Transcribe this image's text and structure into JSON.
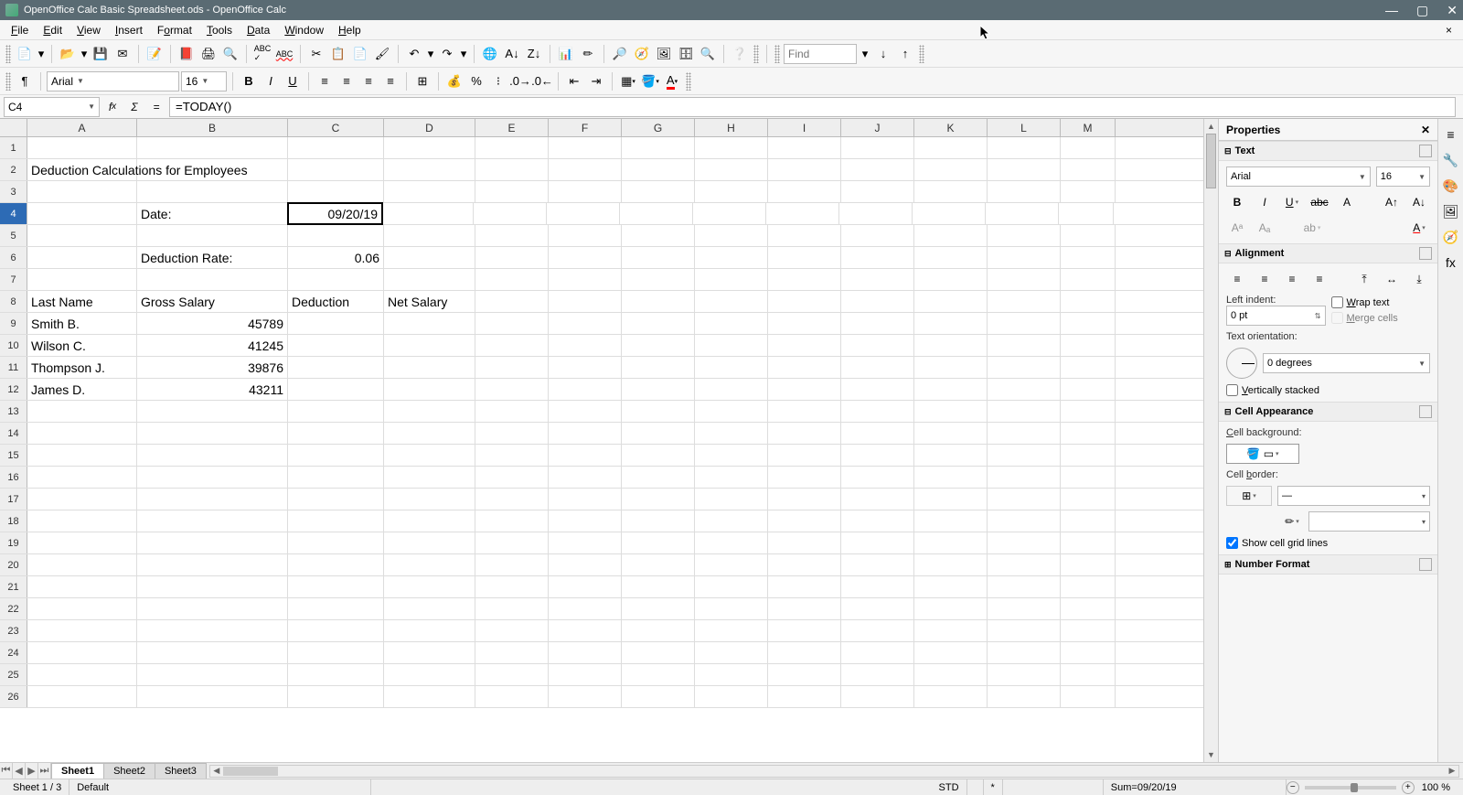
{
  "title": "OpenOffice Calc Basic Spreadsheet.ods - OpenOffice Calc",
  "menus": [
    "File",
    "Edit",
    "View",
    "Insert",
    "Format",
    "Tools",
    "Data",
    "Window",
    "Help"
  ],
  "font": {
    "name": "Arial",
    "size": "16"
  },
  "find_placeholder": "Find",
  "formula": {
    "cell_ref": "C4",
    "content": "=TODAY()"
  },
  "columns": [
    "A",
    "B",
    "C",
    "D",
    "E",
    "F",
    "G",
    "H",
    "I",
    "J",
    "K",
    "L",
    "M"
  ],
  "col_widths": [
    "cw-A",
    "cw-B",
    "cw-C",
    "cw-D",
    "cw-E",
    "cw-F",
    "cw-G",
    "cw-H",
    "cw-I",
    "cw-J",
    "cw-K",
    "cw-L",
    "cw-M"
  ],
  "active_cell": {
    "row": 4,
    "col_index": 2
  },
  "cells": {
    "2": {
      "A": "Deduction Calculations for Employees",
      "overflow": true
    },
    "4": {
      "B": "Date:",
      "C": "09/20/19",
      "C_num": true
    },
    "6": {
      "B": "Deduction Rate:",
      "C": "0.06",
      "C_num": true
    },
    "8": {
      "A": "Last Name",
      "B": "Gross Salary",
      "C": "Deduction",
      "D": "Net Salary"
    },
    "9": {
      "A": "Smith B.",
      "B": "45789",
      "B_num": true
    },
    "10": {
      "A": "Wilson C.",
      "B": "41245",
      "B_num": true
    },
    "11": {
      "A": "Thompson J.",
      "B": "39876",
      "B_num": true
    },
    "12": {
      "A": "James D.",
      "B": "43211",
      "B_num": true
    }
  },
  "row_count": 26,
  "properties": {
    "title": "Properties",
    "text": {
      "header": "Text",
      "font": "Arial",
      "size": "16"
    },
    "alignment": {
      "header": "Alignment",
      "left_indent_label": "Left indent:",
      "left_indent_val": "0 pt",
      "wrap": "Wrap text",
      "merge": "Merge cells",
      "orient_label": "Text orientation:",
      "orient_val": "0 degrees",
      "vstack": "Vertically stacked"
    },
    "appearance": {
      "header": "Cell Appearance",
      "bg_label": "Cell background:",
      "border_label": "Cell border:",
      "grid": "Show cell grid lines"
    },
    "number": {
      "header": "Number Format"
    }
  },
  "tabs": [
    "Sheet1",
    "Sheet2",
    "Sheet3"
  ],
  "status": {
    "sheet": "Sheet 1 / 3",
    "style": "Default",
    "mode": "STD",
    "mod_flag": "*",
    "sum": "Sum=09/20/19",
    "zoom": "100 %"
  }
}
